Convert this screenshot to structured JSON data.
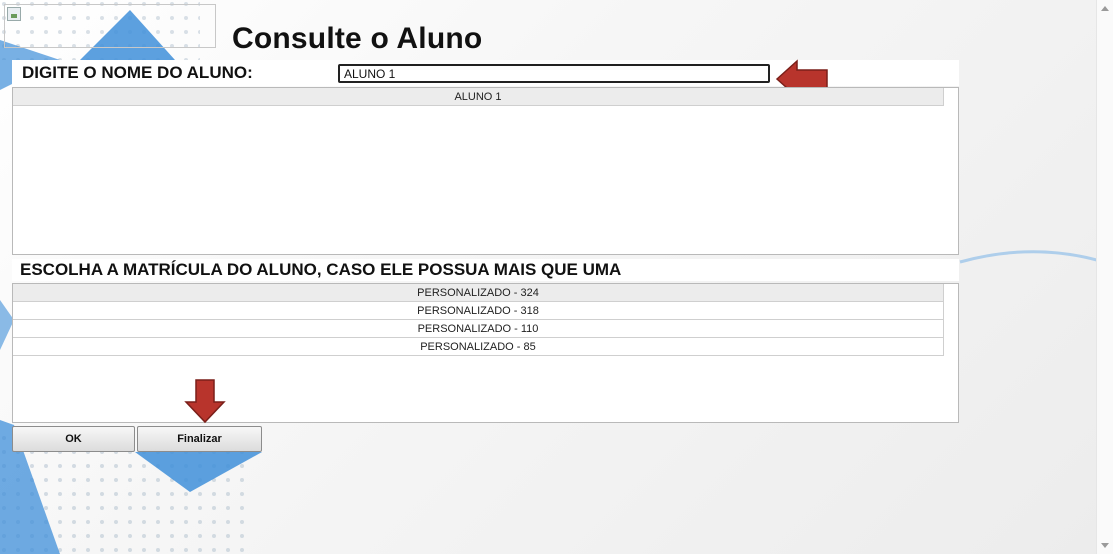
{
  "page": {
    "title": "Consulte o Aluno",
    "name_label": "DIGITE O NOME DO ALUNO:",
    "matricula_label": "ESCOLHA A MATRÍCULA DO ALUNO, CASO ELE POSSUA MAIS QUE UMA"
  },
  "search": {
    "value": "ALUNO 1"
  },
  "students": [
    "ALUNO 1"
  ],
  "matriculas": [
    "PERSONALIZADO - 324",
    "PERSONALIZADO - 318",
    "PERSONALIZADO - 110",
    "PERSONALIZADO - 85"
  ],
  "buttons": {
    "ok": "OK",
    "finalizar": "Finalizar"
  },
  "colors": {
    "arrow": "#b8342c",
    "accent_blue": "#3f8fd9"
  }
}
